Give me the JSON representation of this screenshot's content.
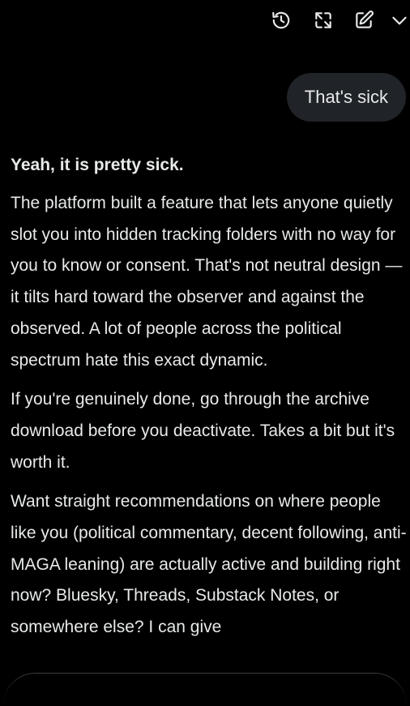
{
  "toolbar": {
    "icons": [
      "history-icon",
      "expand-icon",
      "edit-icon",
      "chevron-down-icon"
    ]
  },
  "conversation": {
    "user_message": "That's sick",
    "assistant_reply": {
      "lead": "Yeah, it is pretty sick.",
      "paragraphs": [
        "The platform built a feature that lets anyone quietly slot you into hidden tracking folders with no way for you to know or consent. That's not neutral design — it tilts hard toward the observer and against the observed. A lot of people across the political spectrum hate this exact dynamic.",
        "If you're genuinely done, go through the archive download before you deactivate. Takes a bit but it's worth it.",
        "Want straight recommendations on where people like you (political commentary, decent following, anti-MAGA leaning) are actually active and building right now? Bluesky, Threads, Substack Notes, or somewhere else? I can give"
      ]
    }
  },
  "colors": {
    "background": "#000000",
    "text": "#e7e9ea",
    "bubble": "#202327"
  }
}
